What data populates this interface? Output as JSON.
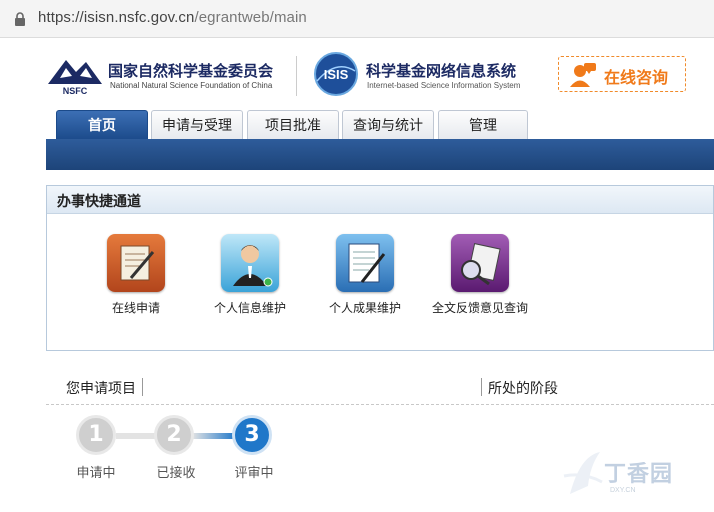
{
  "browser": {
    "url_host": "https://isisn.nsfc.gov.cn",
    "url_path": "/egrantweb/main"
  },
  "header": {
    "nsfc_name_cn": "国家自然科学基金委员会",
    "nsfc_name_en": "National Natural Science Foundation of China",
    "nsfc_logo_text": "NSFC",
    "isis_logo_text": "ISIS",
    "isis_name_cn": "科学基金网络信息系统",
    "isis_name_en": "Internet-based Science Information System",
    "consult_label": "在线咨询"
  },
  "nav": {
    "tabs": [
      {
        "label": "首页",
        "active": true
      },
      {
        "label": "申请与受理",
        "active": false
      },
      {
        "label": "项目批准",
        "active": false
      },
      {
        "label": "查询与统计",
        "active": false
      },
      {
        "label": "管理",
        "active": false
      }
    ]
  },
  "quick": {
    "title": "办事快捷通道",
    "items": [
      {
        "label": "在线申请",
        "icon": "online-application-icon",
        "color": "#c8552a"
      },
      {
        "label": "个人信息维护",
        "icon": "personal-info-icon",
        "color": "#4ab0e0"
      },
      {
        "label": "个人成果维护",
        "icon": "achievement-icon",
        "color": "#3a88c8"
      },
      {
        "label": "全文反馈意见查询",
        "icon": "feedback-query-icon",
        "color": "#7a2a8a"
      }
    ]
  },
  "project": {
    "prefix": "您申请项目",
    "bracket_open": "[",
    "bracket_close": "]",
    "suffix": "所处的阶段"
  },
  "stages": [
    {
      "num": "1",
      "label": "申请中",
      "state": "done"
    },
    {
      "num": "2",
      "label": "已接收",
      "state": "done"
    },
    {
      "num": "3",
      "label": "评审中",
      "state": "current"
    }
  ],
  "watermark": {
    "text": "丁香园",
    "sub": "DXY.CN"
  },
  "colors": {
    "brand": "#1d4479",
    "accent": "#f07a1a",
    "current_step": "#1f77c9"
  }
}
